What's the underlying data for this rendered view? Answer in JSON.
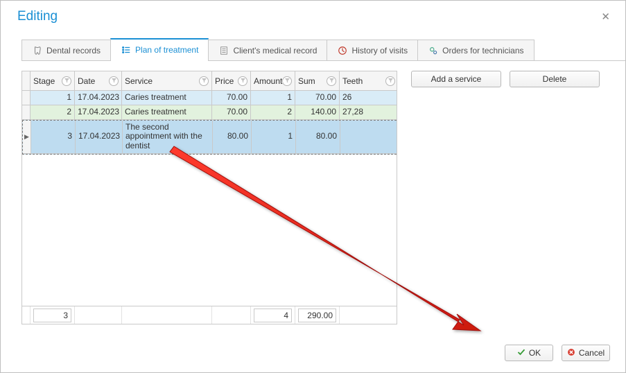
{
  "dialog": {
    "title": "Editing"
  },
  "tabs": [
    {
      "label": "Dental records"
    },
    {
      "label": "Plan of treatment"
    },
    {
      "label": "Client's medical record"
    },
    {
      "label": "History of visits"
    },
    {
      "label": "Orders for technicians"
    }
  ],
  "columns": {
    "stage": "Stage",
    "date": "Date",
    "service": "Service",
    "price": "Price",
    "amount": "Amount",
    "sum": "Sum",
    "teeth": "Teeth"
  },
  "rows": [
    {
      "stage": "1",
      "date": "17.04.2023",
      "service": "Caries treatment",
      "price": "70.00",
      "amount": "1",
      "sum": "70.00",
      "teeth": "26"
    },
    {
      "stage": "2",
      "date": "17.04.2023",
      "service": "Caries treatment",
      "price": "70.00",
      "amount": "2",
      "sum": "140.00",
      "teeth": "27,28"
    },
    {
      "stage": "3",
      "date": "17.04.2023",
      "service": "The second appointment with the dentist",
      "price": "80.00",
      "amount": "1",
      "sum": "80.00",
      "teeth": ""
    }
  ],
  "footer": {
    "stage_total": "3",
    "amount_total": "4",
    "sum_total": "290.00"
  },
  "buttons": {
    "add_service": "Add a service",
    "delete": "Delete",
    "ok": "OK",
    "cancel": "Cancel"
  }
}
